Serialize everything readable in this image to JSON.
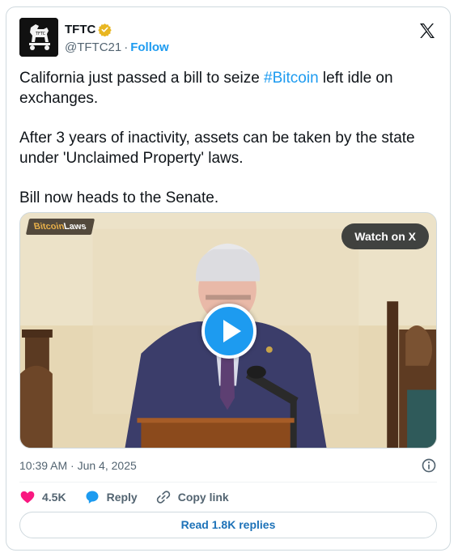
{
  "author": {
    "display_name": "TFTC",
    "handle": "@TFTC21",
    "separator": "·",
    "follow_label": "Follow",
    "verified_color": "#e8b622",
    "avatar_icon": "trojan-horse-logo"
  },
  "tweet": {
    "line1_before": "California just passed a bill to seize ",
    "hashtag": "#Bitcoin",
    "line1_after": " left idle on exchanges.",
    "paragraph2": "After 3 years of inactivity, assets can be taken by the state under 'Unclaimed Property' laws.",
    "paragraph3": "Bill now heads to the Senate."
  },
  "media": {
    "badge_part1": "Bitcoin",
    "badge_part2": " Laws",
    "watch_label": "Watch on X",
    "play_icon": "play-icon"
  },
  "meta": {
    "timestamp": "10:39 AM · Jun 4, 2025",
    "info_icon": "info-icon"
  },
  "actions": {
    "likes_count": "4.5K",
    "reply_label": "Reply",
    "copy_link_label": "Copy link"
  },
  "read_replies_label": "Read 1.8K replies",
  "colors": {
    "accent": "#1d9bf0",
    "like": "#f91880",
    "text_secondary": "#536471"
  }
}
